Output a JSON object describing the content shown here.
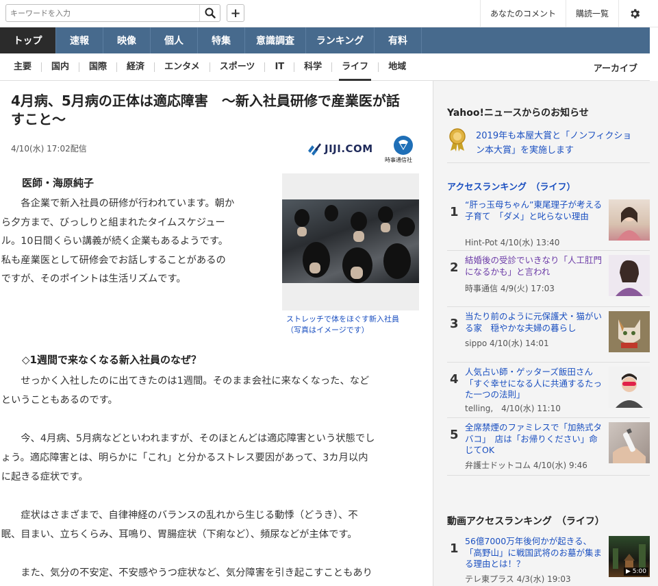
{
  "header": {
    "search_placeholder": "キーワードを入力",
    "links": [
      "あなたのコメント",
      "購読一覧"
    ]
  },
  "mainnav": [
    "トップ",
    "速報",
    "映像",
    "個人",
    "特集",
    "意識調査",
    "ランキング",
    "有料"
  ],
  "subnav": [
    "主要",
    "国内",
    "国際",
    "経済",
    "エンタメ",
    "スポーツ",
    "IT",
    "科学",
    "ライフ",
    "地域"
  ],
  "subnav_archive": "アーカイブ",
  "article": {
    "title_line1": "4月病、5月病の正体は適応障害　～新入社員研修で産業医が話",
    "title_line2": "すこと～",
    "date": "4/10(水) 17:02配信",
    "logo_text": "JIJI.COM",
    "logo_sub": "時事通信社",
    "author": "医師・海原純子",
    "para1_lines": [
      "各企業で新入社員の研修が行われています。朝か",
      "ら夕方まで、びっしりと組まれたタイムスケジュー",
      "ル。10日間くらい講義が続く企業もあるようです。",
      "私も産業医として研修会でお話しすることがあるの",
      "ですが、そのポイントは生活リズムです。"
    ],
    "caption_line1": "ストレッチで体をほぐす新入社員",
    "caption_line2": "（写真はイメージです）",
    "section": "◇1週間で来なくなる新入社員のなぜ？",
    "para2_lines": [
      "せっかく入社したのに出てきたのは1週間。そのまま会社に来なくなった、など",
      "ということもあるのです。"
    ],
    "para3_lines": [
      "今、4月病、5月病などといわれますが、そのほとんどは適応障害という状態でし",
      "ょう。適応障害とは、明らかに「これ」と分かるストレス要因があって、3カ月以内",
      "に起きる症状です。"
    ],
    "para4_lines": [
      "症状はさまざまで、自律神経のバランスの乱れから生じる動悸（どうき）、不",
      "眠、目まい、立ちくらみ、耳鳴り、胃腸症状（下痢など）、頻尿などが主体です。"
    ],
    "para5_lines": [
      "また、気分の不安定、不安感やうつ症状など、気分障害を引き起こすこともあり"
    ]
  },
  "sidebar": {
    "notice_title": "Yahoo!ニュースからのお知らせ",
    "notice_line1": "2019年も本屋大賞と「ノンフィクショ",
    "notice_line2": "ン本大賞」を実施します",
    "ranking_title": "アクセスランキング　（ライフ）",
    "ranking": [
      {
        "num": "1",
        "title": "“肝っ玉母ちゃん”東尾理子が考える子育て　「ダメ」と叱らない理由",
        "meta": "Hint-Pot 4/10(水) 13:40"
      },
      {
        "num": "2",
        "title": "結婚後の受診でいきなり「人工肛門になるかも」と言われ",
        "meta": "時事通信 4/9(火) 17:03"
      },
      {
        "num": "3",
        "title": "当たり前のように元保護犬・猫がいる家　穏やかな夫婦の暮らし",
        "meta": "sippo 4/10(水) 14:01"
      },
      {
        "num": "4",
        "title": "人気占い師・ゲッターズ飯田さん「すぐ幸せになる人に共通するたった一つの法則」",
        "meta": "telling,　4/10(水) 11:10"
      },
      {
        "num": "5",
        "title": "全席禁煙のファミレスで「加熱式タバコ」　店は「お帰りください」命じてOK",
        "meta": "弁護士ドットコム 4/10(水) 9:46"
      }
    ],
    "video_title": "動画アクセスランキング　（ライフ）",
    "video": [
      {
        "num": "1",
        "title": "56億7000万年後何かが起きる、「高野山」に戦国武将のお墓が集まる理由とは！？",
        "meta": "テレ東プラス 4/3(水) 19:03",
        "duration": "▶ 5:00"
      }
    ]
  }
}
